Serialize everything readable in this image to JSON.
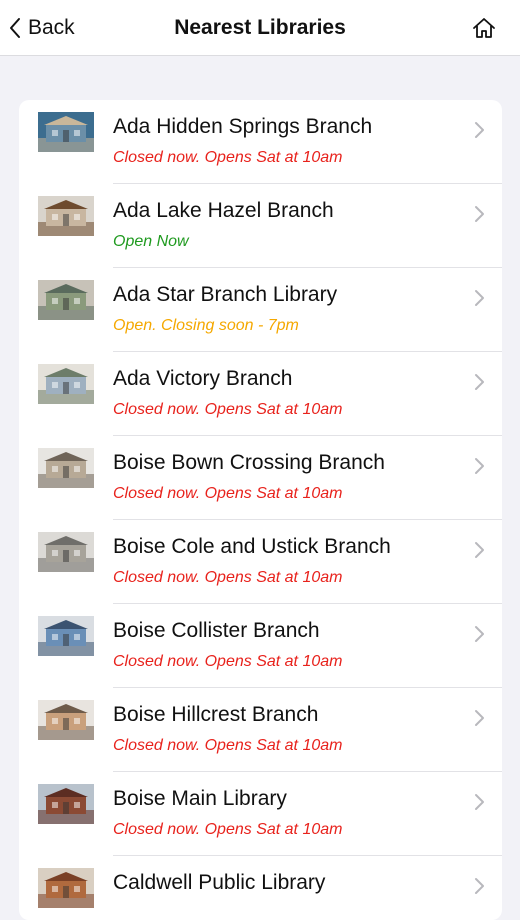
{
  "navbar": {
    "back_label": "Back",
    "title": "Nearest Libraries",
    "home_icon": "home-icon"
  },
  "colors": {
    "closed": "#e8221c",
    "open": "#1f9a1f",
    "closing_soon": "#f5a800"
  },
  "libraries": [
    {
      "name": "Ada Hidden Springs Branch",
      "status": "Closed now. Opens Sat at 10am",
      "state": "closed"
    },
    {
      "name": "Ada Lake Hazel Branch",
      "status": "Open Now",
      "state": "open"
    },
    {
      "name": "Ada Star Branch Library",
      "status": "Open. Closing soon - 7pm",
      "state": "soon"
    },
    {
      "name": "Ada Victory Branch",
      "status": "Closed now. Opens Sat at 10am",
      "state": "closed"
    },
    {
      "name": "Boise Bown Crossing Branch",
      "status": "Closed now. Opens Sat at 10am",
      "state": "closed"
    },
    {
      "name": "Boise Cole and Ustick Branch",
      "status": "Closed now. Opens Sat at 10am",
      "state": "closed"
    },
    {
      "name": "Boise Collister Branch",
      "status": "Closed now. Opens Sat at 10am",
      "state": "closed"
    },
    {
      "name": "Boise Hillcrest Branch",
      "status": "Closed now. Opens Sat at 10am",
      "state": "closed"
    },
    {
      "name": "Boise Main Library",
      "status": "Closed now. Opens Sat at 10am",
      "state": "closed"
    },
    {
      "name": "Caldwell Public Library",
      "status": "",
      "state": "closed"
    }
  ]
}
